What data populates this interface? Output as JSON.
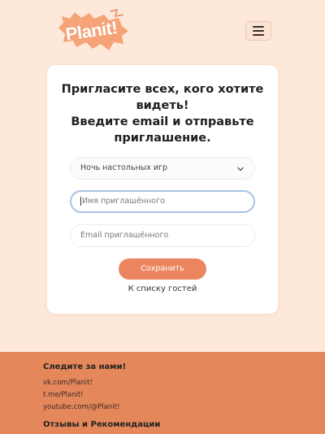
{
  "header": {
    "logo_text": "Planit!",
    "menu_icon": "hamburger-icon"
  },
  "form": {
    "title_lines": [
      "Пригласите всех, кого хотите",
      "видеть!",
      "Введите email и отправьте",
      "приглашение."
    ],
    "event_select": {
      "selected": "Ночь настольных игр",
      "icon": "chevron-down-icon"
    },
    "name_input": {
      "placeholder": "Имя приглашённого",
      "value": ""
    },
    "email_input": {
      "placeholder": "Email приглашённого",
      "value": ""
    },
    "save_label": "Сохранить",
    "back_link": "К списку гостей"
  },
  "footer": {
    "follow_heading": "Следите за нами!",
    "links": [
      "vk.com/Planit!",
      "t.me/Planit!",
      "youtube.com/@Planit!"
    ],
    "reviews_heading": "Отзывы и Рекомендации"
  },
  "colors": {
    "page_bg": "#fde8d9",
    "accent": "#ea8560",
    "footer_bg": "#e4875a",
    "logo_bg": "#f6a377",
    "focus_ring": "#a9c2e8"
  }
}
